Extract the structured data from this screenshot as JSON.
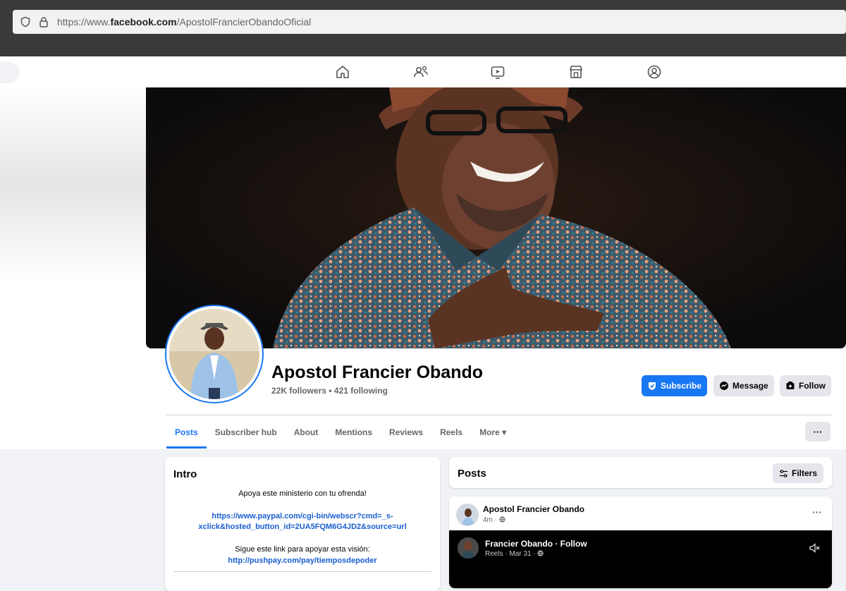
{
  "browser": {
    "url_prefix": "https://www.",
    "url_domain": "facebook.com",
    "url_path": "/ApostolFrancierObandoOficial"
  },
  "nav": {
    "icons": [
      "home-icon",
      "friends-icon",
      "video-icon",
      "marketplace-icon",
      "groups-icon"
    ]
  },
  "profile": {
    "name": "Apostol Francier Obando",
    "stats": "22K followers • 421 following",
    "subscribe_label": "Subscribe",
    "message_label": "Message",
    "follow_label": "Follow"
  },
  "tabs": [
    {
      "label": "Posts",
      "active": true
    },
    {
      "label": "Subscriber hub"
    },
    {
      "label": "About"
    },
    {
      "label": "Mentions"
    },
    {
      "label": "Reviews"
    },
    {
      "label": "Reels"
    },
    {
      "label": "More ▾"
    }
  ],
  "more_button": "···",
  "intro": {
    "title": "Intro",
    "line1": "Apoya este ministerio con tu ofrenda!",
    "link1_a": "https://www.paypal.com/cgi-bin/webscr?cmd=_s-",
    "link1_b": "xclick&hosted_button_id=2UA5FQM6G4JD2&source=url",
    "line2": "Sigue este link para apoyar esta visión:",
    "link2": "http://pushpay.com/pay/tiemposdepoder"
  },
  "posts": {
    "title": "Posts",
    "filters_label": "Filters",
    "post": {
      "author": "Apostol Francier Obando",
      "time": "4m · ",
      "menu": "···",
      "reel_author": "Francier Obando · Follow",
      "reel_sub": "Reels · Mar 31 · "
    }
  },
  "colors": {
    "accent": "#1877f2",
    "background": "#f0f2f5"
  }
}
